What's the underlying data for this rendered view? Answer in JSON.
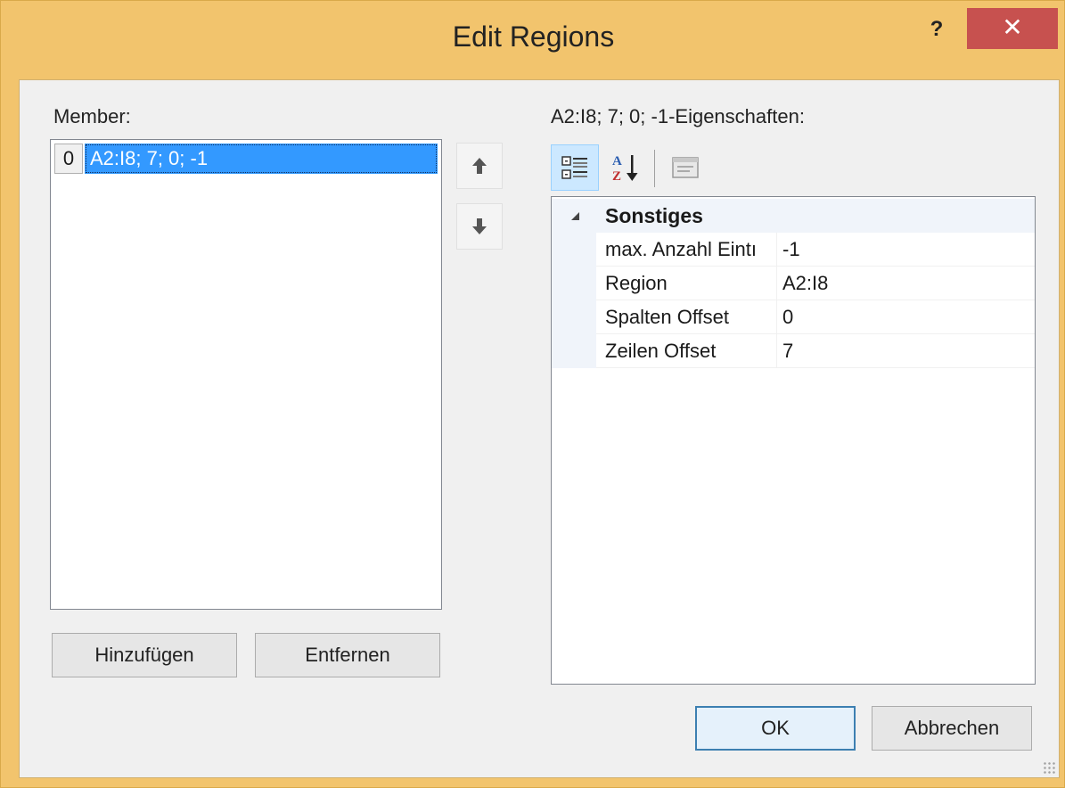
{
  "window": {
    "title": "Edit Regions",
    "help_label": "?",
    "close_label": "✕"
  },
  "member_panel": {
    "label": "Member:",
    "items": [
      {
        "index": "0",
        "value": "A2:I8; 7; 0; -1",
        "selected": true
      }
    ],
    "add_label": "Hinzufügen",
    "remove_label": "Entfernen"
  },
  "move_buttons": {
    "up_icon": "arrow-up-icon",
    "down_icon": "arrow-down-icon"
  },
  "properties_panel": {
    "label": "A2:I8; 7; 0; -1-Eigenschaften:",
    "toolbar": {
      "categorized_icon": "categorized-icon",
      "alphabetical_icon": "alphabetical-sort-icon",
      "property_pages_icon": "property-pages-icon"
    },
    "category": "Sonstiges",
    "rows": [
      {
        "name": "max. Anzahl Eintı",
        "value": "-1"
      },
      {
        "name": "Region",
        "value": "A2:I8"
      },
      {
        "name": "Spalten Offset",
        "value": "0"
      },
      {
        "name": "Zeilen Offset",
        "value": "7"
      }
    ]
  },
  "footer": {
    "ok_label": "OK",
    "cancel_label": "Abbrechen"
  },
  "colors": {
    "title_bar": "#f2c46d",
    "close_button": "#c7514f",
    "selection": "#3399ff"
  }
}
